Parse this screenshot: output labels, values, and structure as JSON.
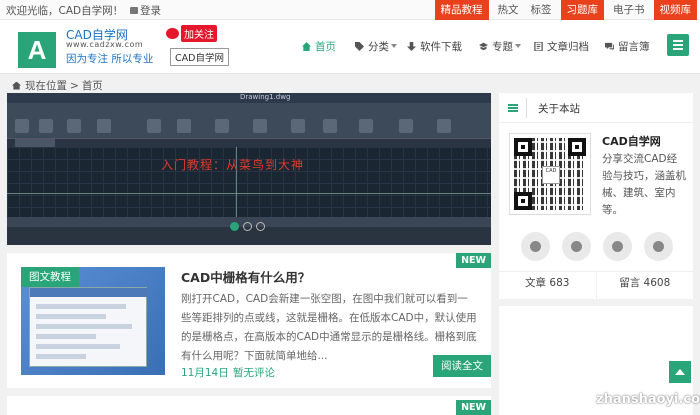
{
  "topbar": {
    "welcome": "欢迎光临，CAD自学网！",
    "login": "登录",
    "links": [
      {
        "label": "精品教程",
        "hot": true
      },
      {
        "label": "热文",
        "hot": false
      },
      {
        "label": "标签",
        "hot": false
      },
      {
        "label": "习题库",
        "hot": true
      },
      {
        "label": "电子书",
        "hot": false
      },
      {
        "label": "视频库",
        "hot": true
      }
    ]
  },
  "header": {
    "logo_letter": "A",
    "logo_name": "CAD自学网",
    "logo_url": "www.cadzxw.com",
    "logo_slogan": "因为专注  所以专业",
    "weibo_follow": "加关注",
    "tooltip": "CAD自学网",
    "nav": [
      {
        "label": "首页",
        "icon": "home-icon",
        "active": true,
        "caret": false
      },
      {
        "label": "分类",
        "icon": "tag-icon",
        "active": false,
        "caret": true
      },
      {
        "label": "软件下载",
        "icon": "download-icon",
        "active": false,
        "caret": false
      },
      {
        "label": "专题",
        "icon": "graduation-cap-icon",
        "active": false,
        "caret": true
      },
      {
        "label": "文章归档",
        "icon": "archive-icon",
        "active": false,
        "caret": false
      },
      {
        "label": "留言簿",
        "icon": "comments-icon",
        "active": false,
        "caret": false
      }
    ]
  },
  "breadcrumb": {
    "prefix": "现在位置",
    "sep": ">",
    "current": "首页"
  },
  "slider": {
    "file_name": "Drawing1.dwg",
    "overlay_text": "入门教程：从菜鸟到大神",
    "slide_count": 3,
    "active_slide": 1
  },
  "article": {
    "category": "图文教程",
    "badge": "NEW",
    "title": "CAD中栅格有什么用？",
    "excerpt": "刚打开CAD，CAD会新建一张空图，在图中我们就可以看到一些等距排列的点或线，这就是栅格。在低版本CAD中，默认使用的是栅格点，在高版本的CAD中通常显示的是栅格线。栅格到底有什么用呢？下面就简单地给...",
    "date": "11月14日",
    "comments": "暂无评论",
    "read_more": "阅读全文"
  },
  "article2": {
    "badge": "NEW"
  },
  "sidebar": {
    "title": "关于本站",
    "site_name": "CAD自学网",
    "description": "分享交流CAD经验与技巧，涵盖机械、建筑、室内等。",
    "qr_center": "CAD",
    "social": [
      "wechat-icon",
      "qq-icon",
      "weibo-icon",
      "rss-icon"
    ],
    "stats": [
      {
        "label": "文章",
        "value": "683"
      },
      {
        "label": "留言",
        "value": "4608"
      }
    ]
  },
  "watermark": "zhanshaoyi.com",
  "colors": {
    "accent": "#2aa57a",
    "hot": "#e8411c",
    "weibo": "#e6162d",
    "link": "#1a73c8"
  }
}
